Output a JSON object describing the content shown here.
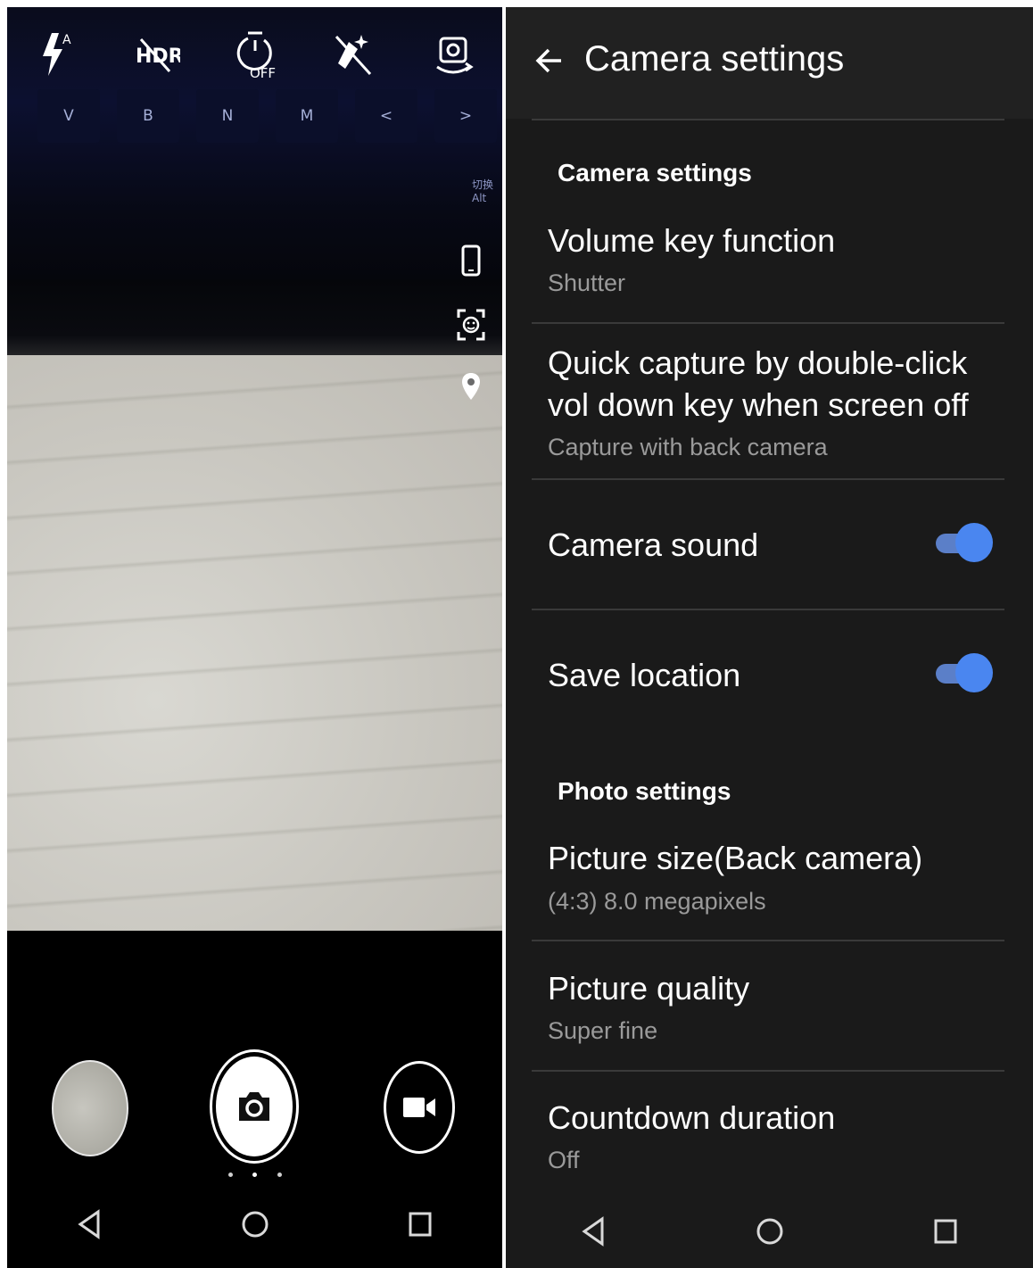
{
  "left": {
    "top_icons": [
      "flash-auto-icon",
      "hdr-off-icon",
      "timer-off-icon",
      "beauty-off-icon",
      "switch-camera-icon"
    ],
    "timer_label": "OFF",
    "flash_label": "A",
    "hdr_label": "HDR",
    "keyboard_keys": [
      "V",
      "B",
      "N",
      "M",
      "<",
      ">"
    ],
    "keyboard_text": "切换 Alt",
    "side_icons": [
      "phone-icon",
      "face-detect-icon",
      "location-pin-icon"
    ],
    "mode_dots": 3
  },
  "right": {
    "header_title": "Camera settings",
    "sections": {
      "camera": "Camera settings",
      "photo": "Photo settings"
    },
    "items": [
      {
        "title": "Volume key function",
        "subtitle": "Shutter"
      },
      {
        "title": "Quick capture by double-click vol down key when screen off",
        "subtitle": "Capture with back camera"
      },
      {
        "title": "Camera sound",
        "toggle": true
      },
      {
        "title": "Save location",
        "toggle": true
      },
      {
        "title": "Picture size(Back camera)",
        "subtitle": "(4:3) 8.0 megapixels"
      },
      {
        "title": "Picture quality",
        "subtitle": "Super fine"
      },
      {
        "title": "Countdown duration",
        "subtitle": "Off"
      }
    ],
    "accent": "#4a86f0"
  }
}
